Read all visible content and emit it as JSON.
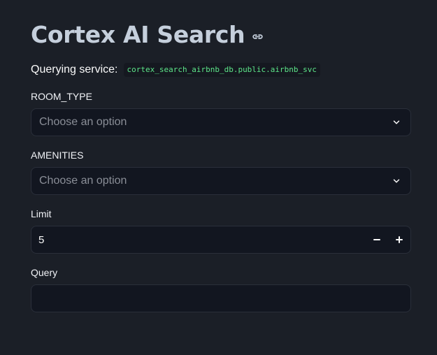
{
  "header": {
    "title": "Cortex AI Search",
    "link_icon": "link-icon"
  },
  "service": {
    "label": "Querying service:",
    "name": "cortex_search_airbnb_db.public.airbnb_svc"
  },
  "fields": {
    "room_type": {
      "label": "ROOM_TYPE",
      "placeholder": "Choose an option",
      "icon": "chevron-down-icon"
    },
    "amenities": {
      "label": "AMENITIES",
      "placeholder": "Choose an option",
      "icon": "chevron-down-icon"
    },
    "limit": {
      "label": "Limit",
      "value": "5",
      "decrement": "−",
      "increment": "+"
    },
    "query": {
      "label": "Query",
      "value": "",
      "placeholder": ""
    }
  },
  "colors": {
    "background": "#1b1f27",
    "input_background": "#121620",
    "title": "#c5cfdc",
    "code": "#5ce488"
  }
}
